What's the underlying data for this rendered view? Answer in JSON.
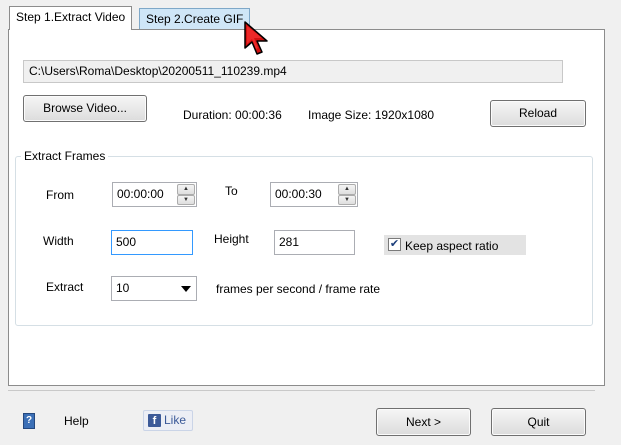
{
  "tabs": [
    {
      "label": "Step 1.Extract Video"
    },
    {
      "label": "Step 2.Create GIF"
    }
  ],
  "video": {
    "path": "C:\\Users\\Roma\\Desktop\\20200511_110239.mp4",
    "browse_label": "Browse Video...",
    "duration_label": "Duration: 00:00:36",
    "image_size_label": "Image Size: 1920x1080",
    "reload_label": "Reload"
  },
  "extract_frames": {
    "title": "Extract Frames",
    "from_label": "From",
    "from_value": "00:00:00",
    "to_label": "To",
    "to_value": "00:00:30",
    "width_label": "Width",
    "width_value": "500",
    "height_label": "Height",
    "height_value": "281",
    "keep_aspect_label": "Keep aspect ratio",
    "keep_aspect_checked": true,
    "extract_label": "Extract",
    "extract_value": "10",
    "fps_label": "frames per second / frame rate"
  },
  "footer": {
    "help_label": "Help",
    "like_label": "Like",
    "next_label": "Next >",
    "quit_label": "Quit"
  },
  "icons": {
    "help": "help-book-icon",
    "facebook": "facebook-logo-icon",
    "cursor": "red-mouse-cursor-icon",
    "spin_up": "spin-up-arrow-icon",
    "spin_down": "spin-down-arrow-icon",
    "dropdown": "chevron-down-icon",
    "check": "checkmark-icon"
  },
  "colors": {
    "window_bg": "#f0f0f0",
    "panel_bg": "#ffffff",
    "inactive_tab_bg": "#cfe6f7",
    "focus_border": "#3399ff",
    "cursor": "#d01010"
  }
}
